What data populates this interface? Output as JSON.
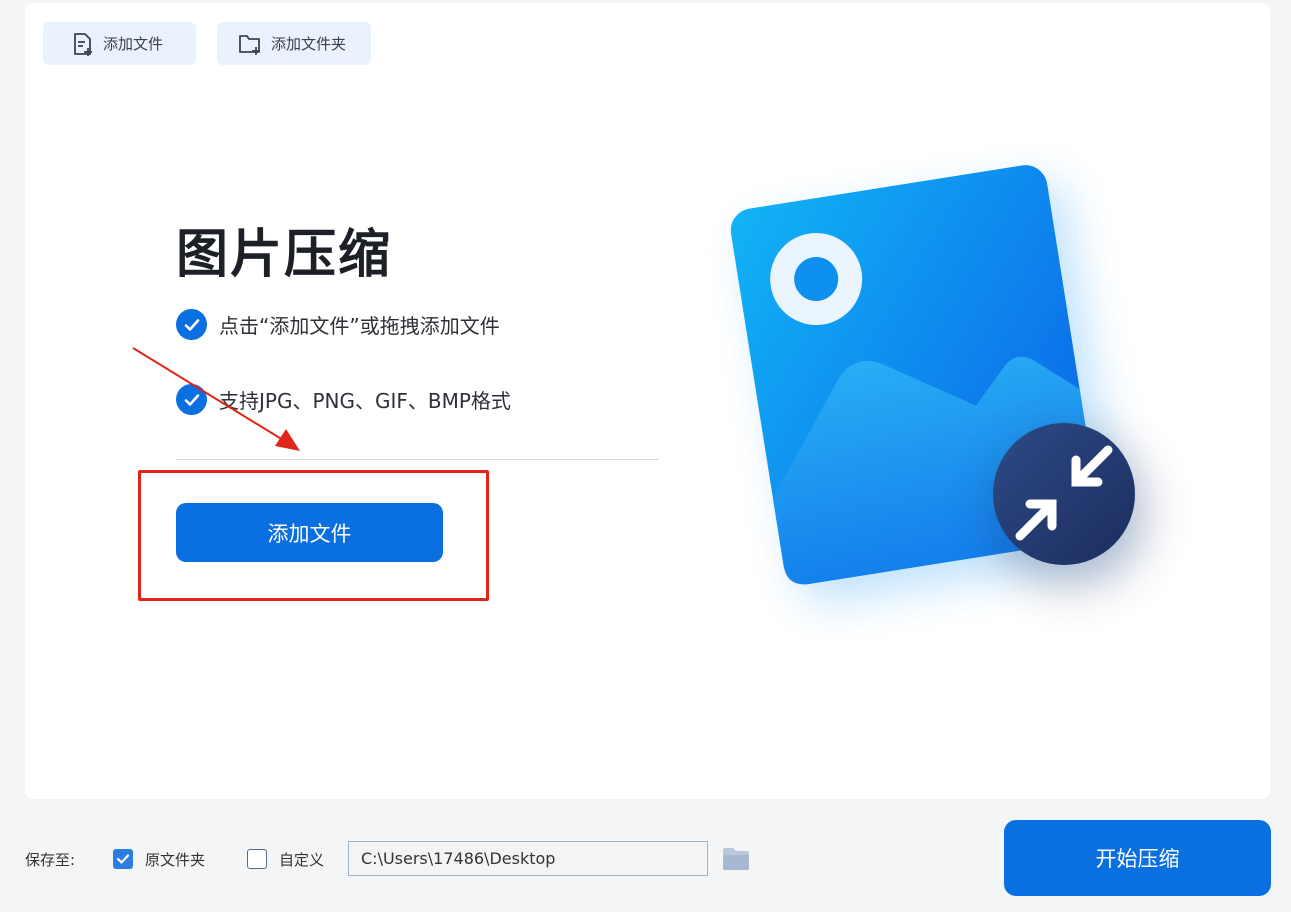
{
  "toolbar": {
    "add_file_label": "添加文件",
    "add_folder_label": "添加文件夹"
  },
  "main": {
    "title": "图片压缩",
    "tips": [
      "点击“添加文件”或拖拽添加文件",
      "支持JPG、PNG、GIF、BMP格式"
    ],
    "add_file_button": "添加文件"
  },
  "bottom": {
    "save_to_label": "保存至:",
    "option_original": {
      "label": "原文件夹",
      "checked": true
    },
    "option_custom": {
      "label": "自定义",
      "checked": false
    },
    "path_value": "C:\\Users\\17486\\Desktop",
    "start_button": "开始压缩"
  },
  "colors": {
    "primary": "#0a6fe0",
    "annotation": "#e1251b",
    "background": "#f4f5f7"
  }
}
